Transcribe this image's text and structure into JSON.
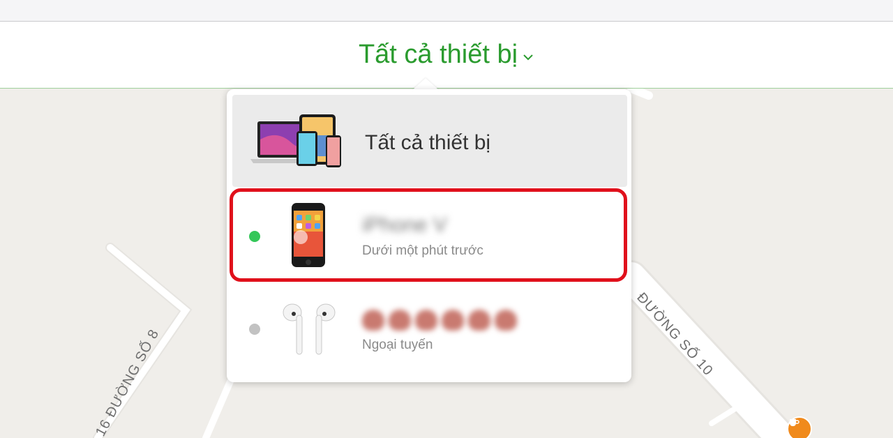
{
  "header": {
    "title": "Tất cả thiết bị",
    "chevron_icon": "chevron-down-icon"
  },
  "dropdown": {
    "all_devices": {
      "label": "Tất cả thiết bị",
      "icon": "all-devices-icon"
    },
    "devices": [
      {
        "name": "iPhone V",
        "status": "Dưới một phút trước",
        "online": true,
        "status_color": "#34c759",
        "icon": "iphone-icon",
        "highlighted": true
      },
      {
        "name": "",
        "status": "Ngoại tuyến",
        "online": false,
        "status_color": "#c2c2c2",
        "icon": "airpods-icon",
        "highlighted": false
      }
    ]
  },
  "map": {
    "streets": [
      "16 ĐƯỜNG SỐ 8",
      "ĐƯỜNG SỐ 10"
    ],
    "poi_icon": "coffee-icon"
  },
  "colors": {
    "accent": "#2a9b2e",
    "highlight": "#e0101b",
    "online": "#34c759",
    "offline": "#c2c2c2"
  }
}
